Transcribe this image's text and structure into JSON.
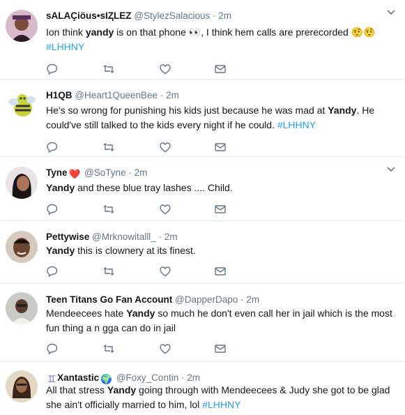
{
  "colors": {
    "link": "#1da1f2",
    "muted": "#657786",
    "text": "#14171a",
    "border": "#e6ecf0"
  },
  "icons": {
    "reply": "speech-bubble",
    "retweet": "retweet-arrows",
    "like": "heart-outline",
    "dm": "envelope",
    "more": "chevron-down"
  },
  "tweets": [
    {
      "name": "sALAÇiöus•sIⱫLEZ",
      "handle": "@StylezSalacious",
      "sep": "·",
      "time": "2m",
      "text_parts": [
        "Ion think ",
        "yandy",
        " is on that phone ",
        "👀",
        ", I think hem calls are prerecorded ",
        "🤨🤨"
      ],
      "hashtag": "#LHHNY"
    },
    {
      "name": "H1QB",
      "handle": "@Heart1QueenBee",
      "sep": "·",
      "time": "2m",
      "text_parts": [
        "He's so wrong for punishing his kids just because he was mad at ",
        "Yandy",
        ". He could've still talked to the kids every night if he could. "
      ],
      "hashtag": "#LHHNY"
    },
    {
      "name": "Tyne",
      "badge": "❤️",
      "handle": "@SoTyne",
      "sep": "·",
      "time": "2m",
      "text_parts": [
        "Yandy",
        " and these blue tray lashes .... Child."
      ]
    },
    {
      "name": "Pettywise",
      "handle": "@Mrknowitalll_",
      "sep": "·",
      "time": "2m",
      "text_parts": [
        "Yandy",
        " this is clownery at its finest."
      ]
    },
    {
      "name": "Teen Titans Go Fan Account",
      "handle": "@DapperDapo",
      "sep": "·",
      "time": "2m",
      "text_parts": [
        "Mendeecees hate ",
        "Yandy",
        " so much he don't even call her in jail which is the most fun thing a n",
        "gga can do in jail"
      ]
    },
    {
      "name": "Xantastic",
      "badge_left": "♊",
      "badge": "🌍",
      "handle": "@Foxy_Contin",
      "sep": "·",
      "time": "2m",
      "text_parts": [
        "All that stress ",
        "Yandy",
        " going through with Mendeecees & Judy she got to be glad she ain't officially married to him, lol "
      ],
      "hashtag": "#LHHNY"
    }
  ]
}
